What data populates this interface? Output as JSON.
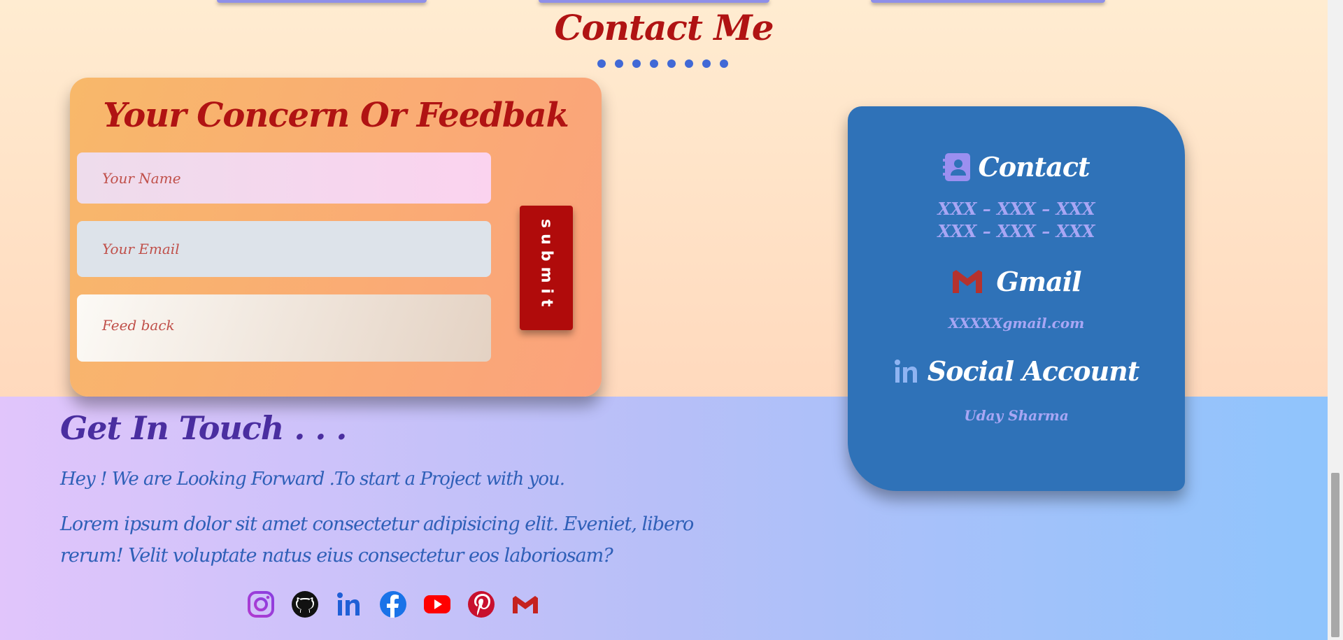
{
  "page": {
    "title": "Contact Me"
  },
  "feedback_form": {
    "title": "Your Concern Or Feedbak",
    "name_placeholder": "Your Name",
    "email_placeholder": "Your Email",
    "feedback_placeholder": "Feed back",
    "submit_label": "submit"
  },
  "contact_card": {
    "contact_heading": "Contact",
    "phone_1": "XXX – XXX – XXX",
    "phone_2": "XXX – XXX – XXX",
    "gmail_heading": "Gmail",
    "email": "XXXXXgmail.com",
    "social_heading": "Social Account",
    "social_name": "Uday Sharma"
  },
  "get_in_touch": {
    "heading": "Get In Touch . . .",
    "subtitle": "Hey ! We are Looking Forward .To start a Project with you.",
    "body": "Lorem ipsum dolor sit amet consectetur adipisicing elit. Eveniet, libero rerum! Velit voluptate natus eius consectetur eos laboriosam?"
  },
  "social_links": [
    {
      "name": "instagram-icon",
      "color": "#a23cd4"
    },
    {
      "name": "github-icon",
      "color": "#111111"
    },
    {
      "name": "linkedin-icon",
      "color": "#1f5fd6"
    },
    {
      "name": "facebook-icon",
      "color": "#1a73e8"
    },
    {
      "name": "youtube-icon",
      "color": "#ff0000"
    },
    {
      "name": "pinterest-icon",
      "color": "#c8102e"
    },
    {
      "name": "gmail-icon",
      "color": "#c5221f"
    }
  ],
  "colors": {
    "title_red": "#b01313",
    "contact_card_blue": "#2f72b8",
    "submit_red": "#b00b0b",
    "dot_blue": "#4169d6"
  }
}
